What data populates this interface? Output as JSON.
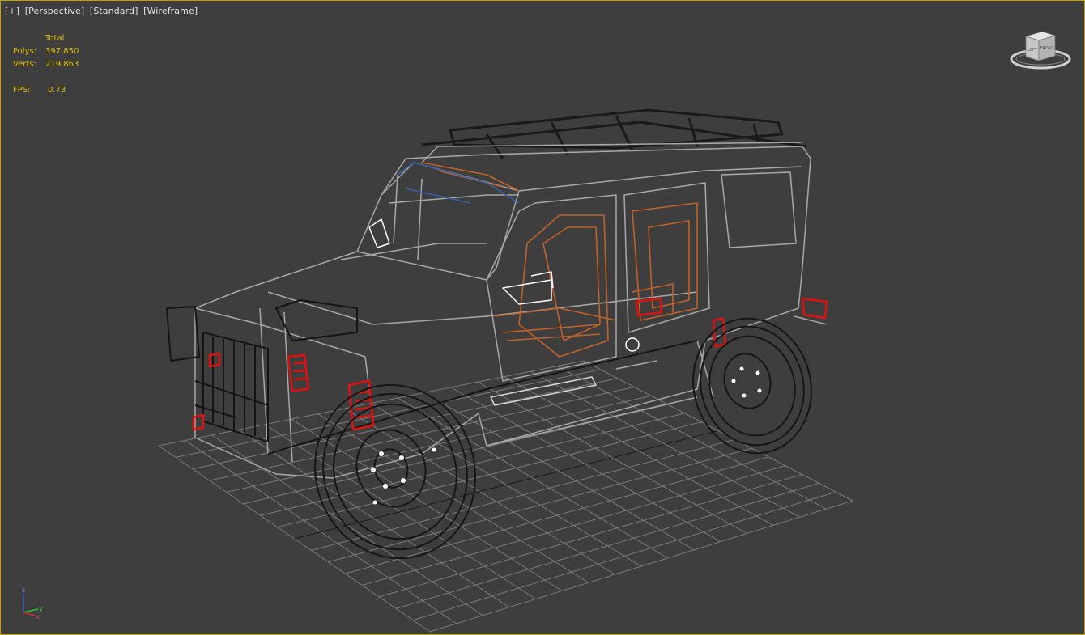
{
  "viewport": {
    "labels": {
      "plus": "[+]",
      "view": "[Perspective]",
      "shading_style": "[Standard]",
      "render_mode": "[Wireframe]"
    },
    "stats": {
      "header": "Total",
      "polys_label": "Polys:",
      "polys_value": "397,850",
      "verts_label": "Verts:",
      "verts_value": "219,863",
      "fps_label": "FPS:",
      "fps_value": "0.73"
    },
    "viewcube": {
      "face_front": "LEFT",
      "face_right": "FRONT"
    },
    "axis_tripod": {
      "z": "z",
      "y": "y",
      "x": "x"
    },
    "colors": {
      "background": "#3e3e3e",
      "border_active": "#c8a200",
      "stats_text": "#e0c000",
      "grid": "#7a7a7a",
      "wire_body": "#9a9a9a",
      "wire_interior": "#c0622a",
      "wire_accent": "#e01010"
    }
  }
}
